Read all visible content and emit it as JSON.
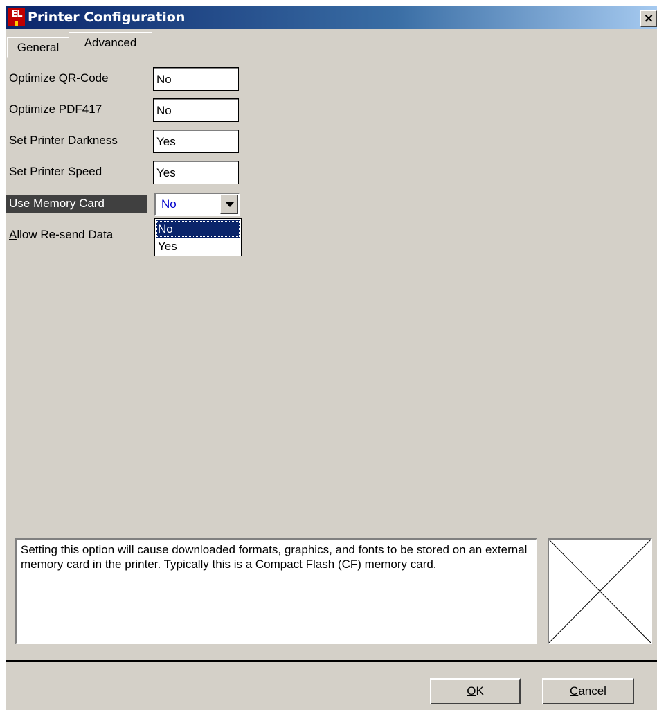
{
  "window": {
    "title": "Printer Configuration",
    "app_icon_text": "EL",
    "close_glyph": "×"
  },
  "tabs": [
    {
      "label": "General"
    },
    {
      "label": "Advanced"
    }
  ],
  "settings": [
    {
      "label": "Optimize QR-Code",
      "value": "No"
    },
    {
      "label": "Optimize PDF417",
      "value": "No"
    },
    {
      "label_first": "S",
      "label_rest": "et Printer Darkness",
      "value": "Yes"
    },
    {
      "label": "Set Printer Speed",
      "value": "Yes"
    },
    {
      "label": "Use Memory Card",
      "value": "No"
    },
    {
      "label_first": "A",
      "label_rest": "llow Re-send Data"
    }
  ],
  "dropdown": {
    "options": [
      "No",
      "Yes"
    ],
    "selected": "No"
  },
  "description": "Setting this option will cause downloaded formats, graphics, and fonts to be stored on an external memory card in the printer. Typically this is a Compact Flash (CF) memory card.",
  "buttons": {
    "ok_first": "O",
    "ok_rest": "K",
    "cancel_first": "C",
    "cancel_rest": "ancel"
  }
}
